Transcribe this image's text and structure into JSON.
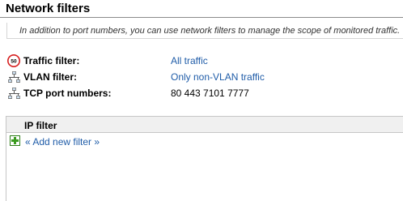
{
  "page": {
    "title": "Network filters",
    "description": "In addition to port numbers, you can use network filters to manage the scope of monitored traffic."
  },
  "settings": [
    {
      "icon": "speed-limit-icon",
      "label": "Traffic filter:",
      "value": "All traffic",
      "is_link": true
    },
    {
      "icon": "network-icon",
      "label": "VLAN filter:",
      "value": "Only non-VLAN traffic",
      "is_link": true
    },
    {
      "icon": "network-icon",
      "label": "TCP port numbers:",
      "value": "80 443 7101 7777",
      "is_link": false
    }
  ],
  "ip_filter": {
    "header": "IP filter",
    "add_label": "« Add new filter »",
    "add_icon": "plus-icon"
  },
  "colors": {
    "link": "#1f5ca8",
    "header_bg": "#f0f0f0",
    "add_icon_green": "#3a9b1f",
    "speed_limit_red": "#d61f1f"
  }
}
